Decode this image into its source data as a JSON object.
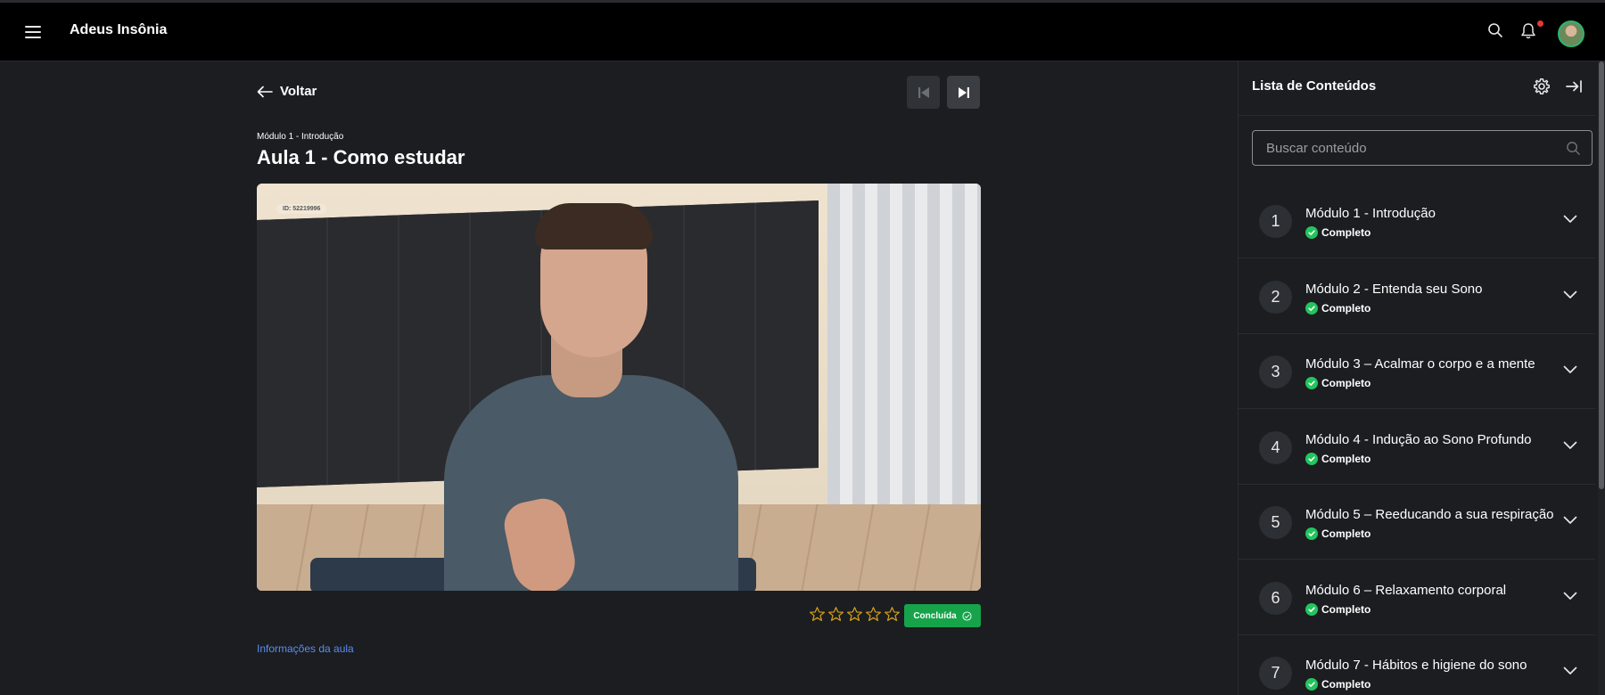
{
  "header": {
    "app_title": "Adeus Insônia",
    "icons": [
      "menu-icon",
      "search-icon",
      "bell-icon",
      "avatar"
    ],
    "notification_dot_color": "#e53935"
  },
  "main": {
    "back_label": "Voltar",
    "breadcrumb": "Módulo 1 - Introdução",
    "lesson_title": "Aula 1 - Como estudar",
    "video_id_label": "ID: 52219996",
    "rating": {
      "stars": 5,
      "filled": 0,
      "color": "#d4a017"
    },
    "done_label": "Concluída",
    "done_color": "#16a34a",
    "info_link": "Informações da aula"
  },
  "sidebar": {
    "title": "Lista de Conteúdos",
    "search_placeholder": "Buscar conteúdo",
    "modules": [
      {
        "number": "1",
        "title": "Módulo 1 - Introdução",
        "status": "Completo"
      },
      {
        "number": "2",
        "title": "Módulo 2 - Entenda seu Sono",
        "status": "Completo"
      },
      {
        "number": "3",
        "title": "Módulo 3 – Acalmar o corpo e a mente",
        "status": "Completo"
      },
      {
        "number": "4",
        "title": "Módulo 4 - Indução ao Sono Profundo",
        "status": "Completo"
      },
      {
        "number": "5",
        "title": "Módulo 5 – Reeducando a sua respiração",
        "status": "Completo"
      },
      {
        "number": "6",
        "title": "Módulo 6 – Relaxamento corporal",
        "status": "Completo"
      },
      {
        "number": "7",
        "title": "Módulo 7 - Hábitos e higiene do sono",
        "status": "Completo"
      }
    ],
    "status_color": "#22c55e"
  }
}
